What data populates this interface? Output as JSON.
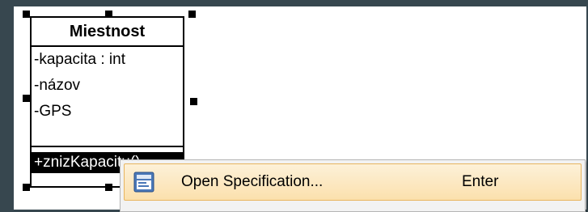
{
  "diagram": {
    "class_name": "Miestnost",
    "attributes": [
      "-kapacita : int",
      "-názov",
      "-GPS"
    ],
    "operations": [
      "+znizKapacitu()"
    ]
  },
  "context_menu": {
    "items": [
      {
        "label": "Open Specification...",
        "shortcut": "Enter",
        "icon": "specification-icon",
        "highlighted": true
      }
    ]
  },
  "colors": {
    "background": "#37474f",
    "canvas": "#ffffff",
    "selection_handle": "#000000",
    "operation_highlight": "#000000",
    "menu_hover": "#fbe0ad",
    "menu_border": "#e8b55f"
  }
}
